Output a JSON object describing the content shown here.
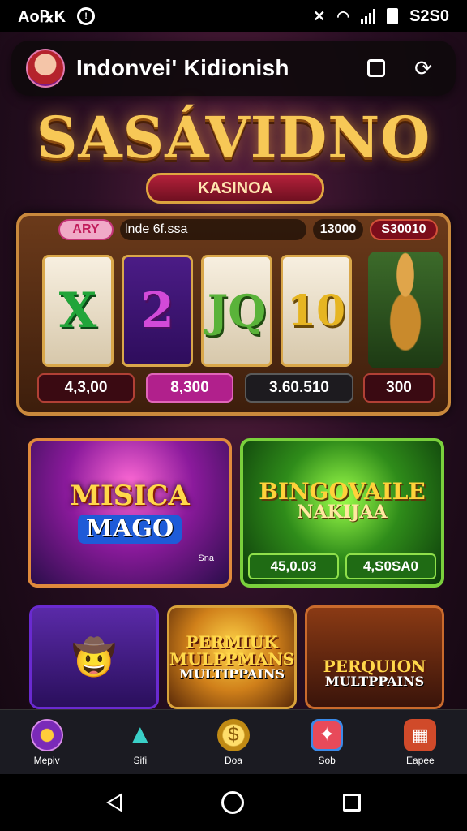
{
  "status": {
    "left_text": "Aᴏ℞K",
    "circle_glyph": "!",
    "time": "S2S0"
  },
  "header": {
    "title": "Indonvei' Kidionish"
  },
  "logo": {
    "title": "SASÁVIDNO",
    "subtitle": "KASINOA"
  },
  "slot": {
    "badge": "ARY",
    "info": "lnde 6f.ssa",
    "count": "13000",
    "credit": "S30010",
    "reels": [
      "X",
      "2",
      "JQ",
      "10"
    ],
    "values": [
      "4,3,00",
      "8,300",
      "3.60.510",
      "300"
    ]
  },
  "cards": {
    "misica": {
      "title": "MISICA",
      "subtitle": "MAGO",
      "tag": "Sna"
    },
    "bingo": {
      "title": "BINGOVAILE",
      "subtitle": "NAKIJAA",
      "btn1": "45,0.03",
      "btn2": "4,S0SA0"
    },
    "small1": {
      "label": ""
    },
    "small2": {
      "title": "PERMIUK MULPPMANS",
      "subtitle": "MULTIPPAINS"
    },
    "small3": {
      "title": "PERQUION",
      "subtitle": "MULTPPAINS"
    }
  },
  "bottom_nav": [
    {
      "label": "Mepiv",
      "icon": "star-badge-icon"
    },
    {
      "label": "Sifi",
      "icon": "triangle-logo-icon"
    },
    {
      "label": "Doa",
      "icon": "coin-icon"
    },
    {
      "label": "Sob",
      "icon": "app-card-icon"
    },
    {
      "label": "Eapee",
      "icon": "briefcase-icon"
    }
  ]
}
